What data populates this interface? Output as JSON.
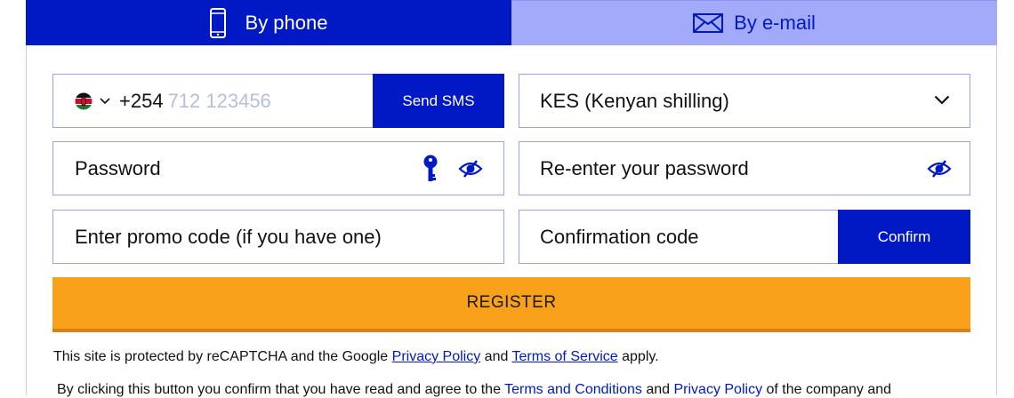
{
  "tabs": {
    "phone_label": "By phone",
    "email_label": "By e-mail"
  },
  "phone": {
    "country_flag": "kenya-flag-icon",
    "prefix": "+254",
    "placeholder": "712 123456",
    "send_sms_label": "Send SMS"
  },
  "currency": {
    "value": "KES (Kenyan shilling)"
  },
  "password": {
    "placeholder": "Password"
  },
  "repassword": {
    "placeholder": "Re-enter your password"
  },
  "promo": {
    "placeholder": "Enter promo code (if you have one)"
  },
  "confirmation": {
    "placeholder": "Confirmation code",
    "confirm_label": "Confirm"
  },
  "register_label": "REGISTER",
  "captcha": {
    "prefix": "This site is protected by reCAPTCHA and the Google",
    "privacy_link": "Privacy Policy",
    "and": "and",
    "terms_link": "Terms of Service",
    "suffix": "apply."
  },
  "agreement": {
    "prefix": "By clicking this button you confirm that you have read and agree to the",
    "terms_link": "Terms and Conditions",
    "and": "and",
    "privacy_link": "Privacy Policy",
    "suffix": "of the company and"
  },
  "colors": {
    "primary": "#0019c4",
    "tab_inactive": "#a3aaf9",
    "register": "#f9a11b",
    "field_border": "#9aa2f0"
  }
}
